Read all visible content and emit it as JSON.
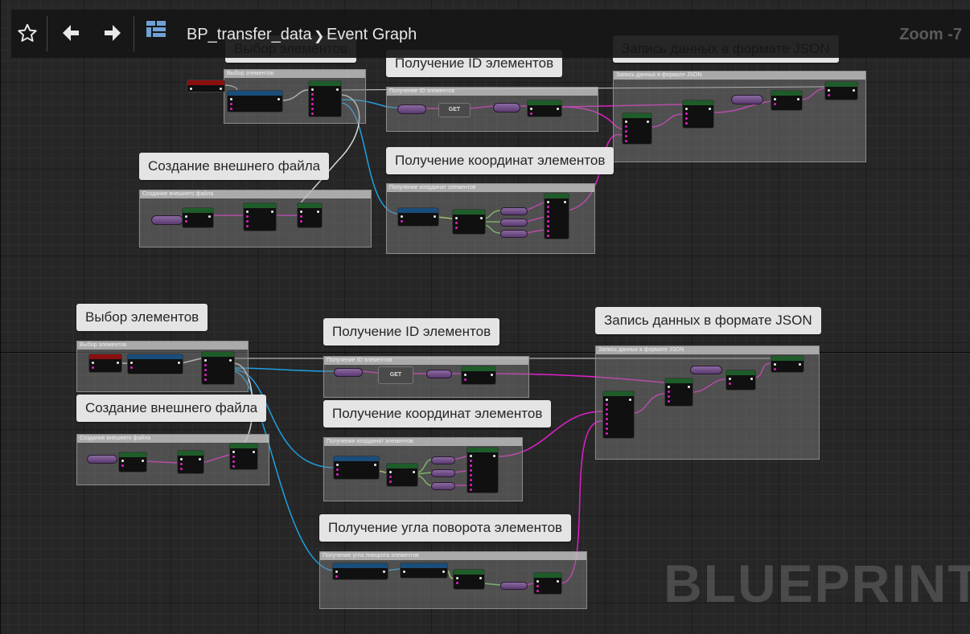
{
  "toolbar": {
    "favorite_icon": "star-icon",
    "back_icon": "arrow-left-icon",
    "forward_icon": "arrow-right-icon",
    "asset_icon": "blueprint-grid-icon",
    "asset_name": "BP_transfer_data",
    "separator": "❯",
    "graph_name": "Event Graph",
    "zoom": "Zoom -7"
  },
  "bubbles": {
    "top_select": "Выбор элементов",
    "top_ids": "Получение ID элементов",
    "top_json": "Запись данных в формате JSON",
    "top_file": "Создание внешнего файла",
    "top_coords": "Получение координат элементов",
    "bottom_select": "Выбор элементов",
    "bottom_ids": "Получение ID элементов",
    "bottom_json": "Запись данных в формате JSON",
    "bottom_file": "Создание внешнего файла",
    "bottom_coords": "Получение координат элементов",
    "bottom_rotation": "Получение угла поворота элементов"
  },
  "comment_headers": {
    "top_select": "Выбор элементов",
    "top_ids": "Получение ID элементов",
    "top_json": "Запись данных в формате JSON",
    "top_file": "Создание внешнего файла",
    "top_coords": "Получение координат элементов",
    "bottom_select": "Выбор элементов",
    "bottom_ids": "Получение ID элементов",
    "bottom_json": "Запись данных в формате JSON",
    "bottom_file": "Создание внешнего файла",
    "bottom_coords": "Получение координат элементов",
    "bottom_rotation": "Получение угла поворота элементов"
  },
  "node_labels": {
    "get": "GET"
  },
  "watermark": "BLUEPRINT",
  "colors": {
    "exec_wire": "#d8d8d8",
    "object_wire": "#1f9fe0",
    "string_wire": "#e020c8",
    "vector_wire": "#b6f05a",
    "float_wire": "#7ad855",
    "event_header": "#8a1010",
    "function_header": "#1e5c2a",
    "pure_header": "#1a4d7a"
  }
}
